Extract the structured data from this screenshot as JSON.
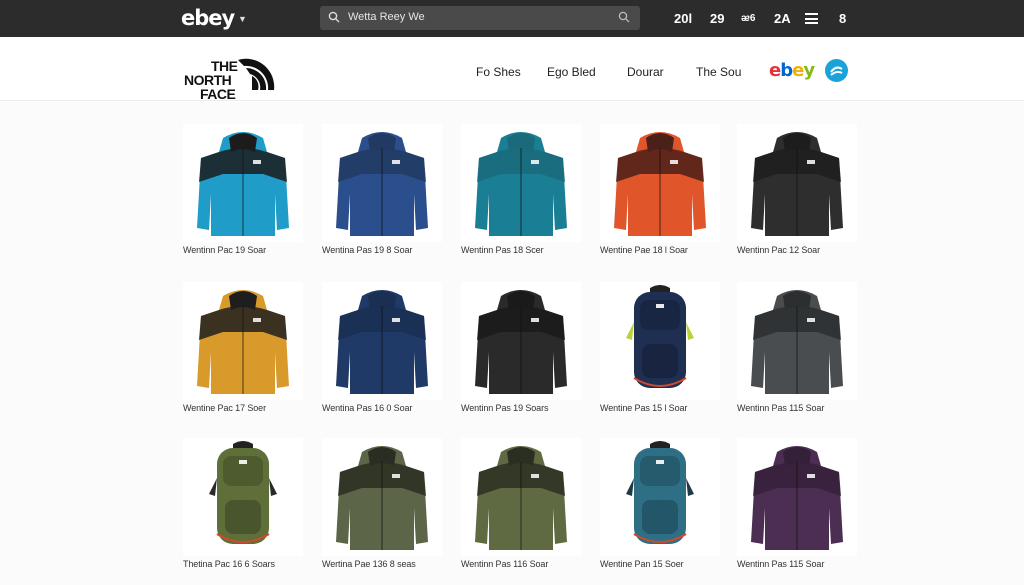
{
  "topbar": {
    "logo": "ebey",
    "search_text": "Wetta Reey We",
    "nav": [
      "20l",
      "29",
      "ᴂ6",
      "2A",
      "8"
    ]
  },
  "brand": {
    "line1": "THE",
    "line2": "NORTH",
    "line3": "FACE",
    "links": [
      "Fo Shes",
      "Ego Bled",
      "Dourar",
      "The Sou"
    ],
    "ebay_logo": [
      "e",
      "b",
      "e",
      "y"
    ]
  },
  "products": [
    {
      "caption": "Wentinn Pac 19 Soar",
      "kind": "jacket",
      "color": "#1f9cc8",
      "yoke": "#1c1c1c"
    },
    {
      "caption": "Wentina Pas 19 8 Soar",
      "kind": "jacket",
      "color": "#2a4f8c",
      "yoke": "#223a63"
    },
    {
      "caption": "Wentinn Pas 18 Scer",
      "kind": "jacket",
      "color": "#1a7f94",
      "yoke": "#1a6a7b"
    },
    {
      "caption": "Wentine Pae 18 l Soar",
      "kind": "jacket",
      "color": "#e1552a",
      "yoke": "#4a2018"
    },
    {
      "caption": "Wentinn Pac 12 Soar",
      "kind": "jacket",
      "color": "#2e2e2e",
      "yoke": "#1d1d1d"
    },
    {
      "caption": "Wentine Pac 17 Soer",
      "kind": "jacket",
      "color": "#d89a2b",
      "yoke": "#1e1e1e"
    },
    {
      "caption": "Wentina Pas 16 0 Soar",
      "kind": "jacket",
      "color": "#1f3a66",
      "yoke": "#1b2f52"
    },
    {
      "caption": "Wentinn Pas 19 Soars",
      "kind": "jacket",
      "color": "#2a2a2a",
      "yoke": "#1a1a1a"
    },
    {
      "caption": "Wentine Pas 15 l Soar",
      "kind": "backpack",
      "color": "#1f2f52",
      "yoke": "#b7d23a"
    },
    {
      "caption": "Wentinn Pas 115 Soar",
      "kind": "jacket",
      "color": "#4a4d4f",
      "yoke": "#2c2f30"
    },
    {
      "caption": "Thetina Pac 16 6 Soars",
      "kind": "backpack",
      "color": "#5e6f3a",
      "yoke": "#2a2a2a"
    },
    {
      "caption": "Wertina Pae 136 8 seas",
      "kind": "jacket",
      "color": "#5c6548",
      "yoke": "#2a2e22"
    },
    {
      "caption": "Wentinn Pas 116 Soar",
      "kind": "jacket",
      "color": "#5f6a43",
      "yoke": "#2b2f22"
    },
    {
      "caption": "Wentine Pan 15 Soer",
      "kind": "backpack",
      "color": "#2e6f86",
      "yoke": "#1f3a44"
    },
    {
      "caption": "Wentinn Pas 115 Soar",
      "kind": "jacket",
      "color": "#4c2e52",
      "yoke": "#35203a"
    }
  ]
}
